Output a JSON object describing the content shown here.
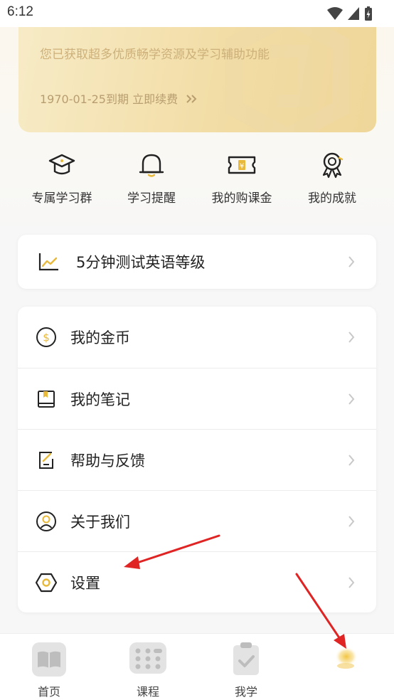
{
  "status_bar": {
    "time": "6:12"
  },
  "vip": {
    "description": "您已获取超多优质畅学资源及学习辅助功能",
    "expire": "1970-01-25到期 立即续费",
    "expire_icon": "double-chevron-right-icon"
  },
  "quick_actions": [
    {
      "label": "专属学习群",
      "icon": "graduation-cap-icon"
    },
    {
      "label": "学习提醒",
      "icon": "bell-icon"
    },
    {
      "label": "我的购课金",
      "icon": "coupon-icon"
    },
    {
      "label": "我的成就",
      "icon": "award-medal-icon"
    }
  ],
  "test_card": {
    "label": "5分钟测试英语等级",
    "icon": "trend-chart-icon"
  },
  "menu": [
    {
      "label": "我的金币",
      "icon": "coin-icon"
    },
    {
      "label": "我的笔记",
      "icon": "notebook-icon"
    },
    {
      "label": "帮助与反馈",
      "icon": "feedback-icon"
    },
    {
      "label": "关于我们",
      "icon": "user-circle-icon"
    },
    {
      "label": "设置",
      "icon": "settings-hexagon-icon"
    }
  ],
  "tabs": [
    {
      "label": "首页",
      "icon": "book-icon"
    },
    {
      "label": "课程",
      "icon": "grid-icon"
    },
    {
      "label": "我学",
      "icon": "clipboard-check-icon"
    },
    {
      "label": "",
      "icon": "profile-glow-icon"
    }
  ],
  "colors": {
    "accent_gold": "#e8b93a",
    "vip_text": "#cdb07a",
    "annotation_arrow": "#e02424"
  }
}
